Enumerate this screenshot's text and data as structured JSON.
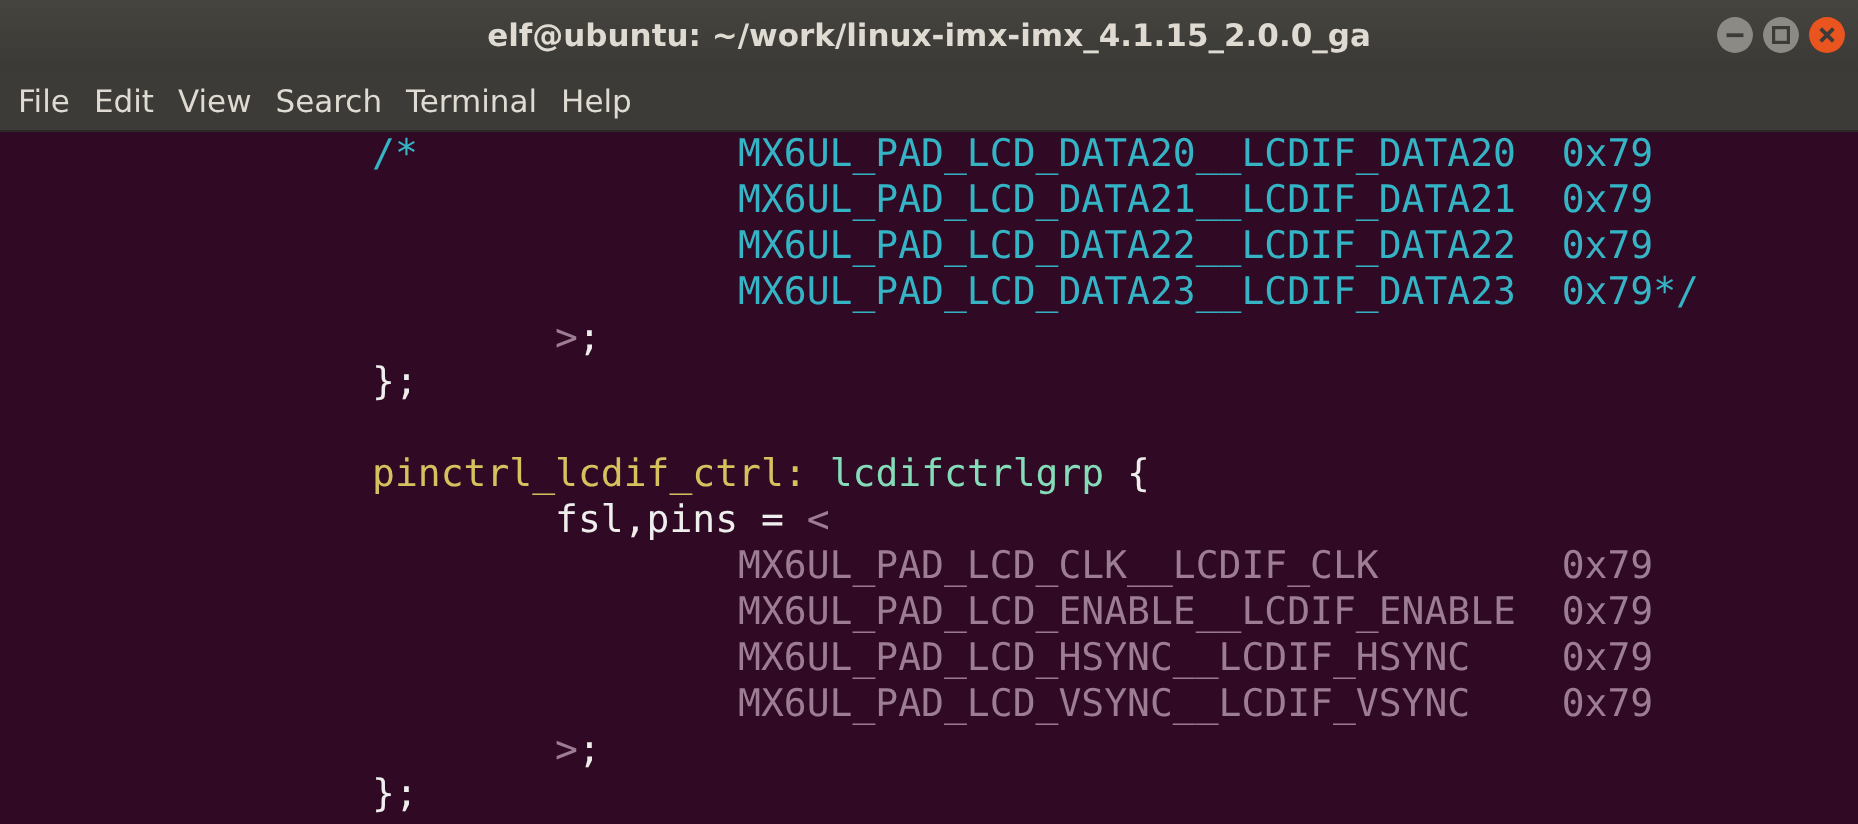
{
  "window": {
    "title": "elf@ubuntu: ~/work/linux-imx-imx_4.1.15_2.0.0_ga"
  },
  "menu": [
    "File",
    "Edit",
    "View",
    "Search",
    "Terminal",
    "Help"
  ],
  "lines": [
    {
      "kind": "code",
      "segments": [
        {
          "kind": "comment",
          "text": "                /*              MX6UL_PAD_LCD_DATA20__LCDIF_DATA20  0x79"
        }
      ]
    },
    {
      "kind": "code",
      "segments": [
        {
          "kind": "comment",
          "text": "                                MX6UL_PAD_LCD_DATA21__LCDIF_DATA21  0x79"
        }
      ]
    },
    {
      "kind": "code",
      "segments": [
        {
          "kind": "comment",
          "text": "                                MX6UL_PAD_LCD_DATA22__LCDIF_DATA22  0x79"
        }
      ]
    },
    {
      "kind": "code",
      "segments": [
        {
          "kind": "comment",
          "text": "                                MX6UL_PAD_LCD_DATA23__LCDIF_DATA23  0x79*/"
        }
      ]
    },
    {
      "kind": "code",
      "segments": [
        {
          "kind": "macro",
          "text": "                        >"
        },
        {
          "kind": "plain",
          "text": ";"
        }
      ]
    },
    {
      "kind": "code",
      "segments": [
        {
          "kind": "plain",
          "text": "                };"
        }
      ]
    },
    {
      "kind": "blank"
    },
    {
      "kind": "code",
      "segments": [
        {
          "kind": "label",
          "text": "                pinctrl_lcdif_ctrl: "
        },
        {
          "kind": "node",
          "text": "lcdifctrlgrp"
        },
        {
          "kind": "plain",
          "text": " {"
        }
      ]
    },
    {
      "kind": "code",
      "segments": [
        {
          "kind": "plain",
          "text": "                        fsl,pins = "
        },
        {
          "kind": "macro",
          "text": "<"
        }
      ]
    },
    {
      "kind": "code",
      "segments": [
        {
          "kind": "macro",
          "text": "                                MX6UL_PAD_LCD_CLK__LCDIF_CLK        0x79"
        }
      ]
    },
    {
      "kind": "code",
      "segments": [
        {
          "kind": "macro",
          "text": "                                MX6UL_PAD_LCD_ENABLE__LCDIF_ENABLE  0x79"
        }
      ]
    },
    {
      "kind": "code",
      "segments": [
        {
          "kind": "macro",
          "text": "                                MX6UL_PAD_LCD_HSYNC__LCDIF_HSYNC    0x79"
        }
      ]
    },
    {
      "kind": "code",
      "segments": [
        {
          "kind": "macro",
          "text": "                                MX6UL_PAD_LCD_VSYNC__LCDIF_VSYNC    0x79"
        }
      ]
    },
    {
      "kind": "code",
      "segments": [
        {
          "kind": "macro",
          "text": "                        >"
        },
        {
          "kind": "plain",
          "text": ";"
        }
      ]
    },
    {
      "kind": "code",
      "segments": [
        {
          "kind": "plain",
          "text": "                };"
        }
      ]
    }
  ]
}
